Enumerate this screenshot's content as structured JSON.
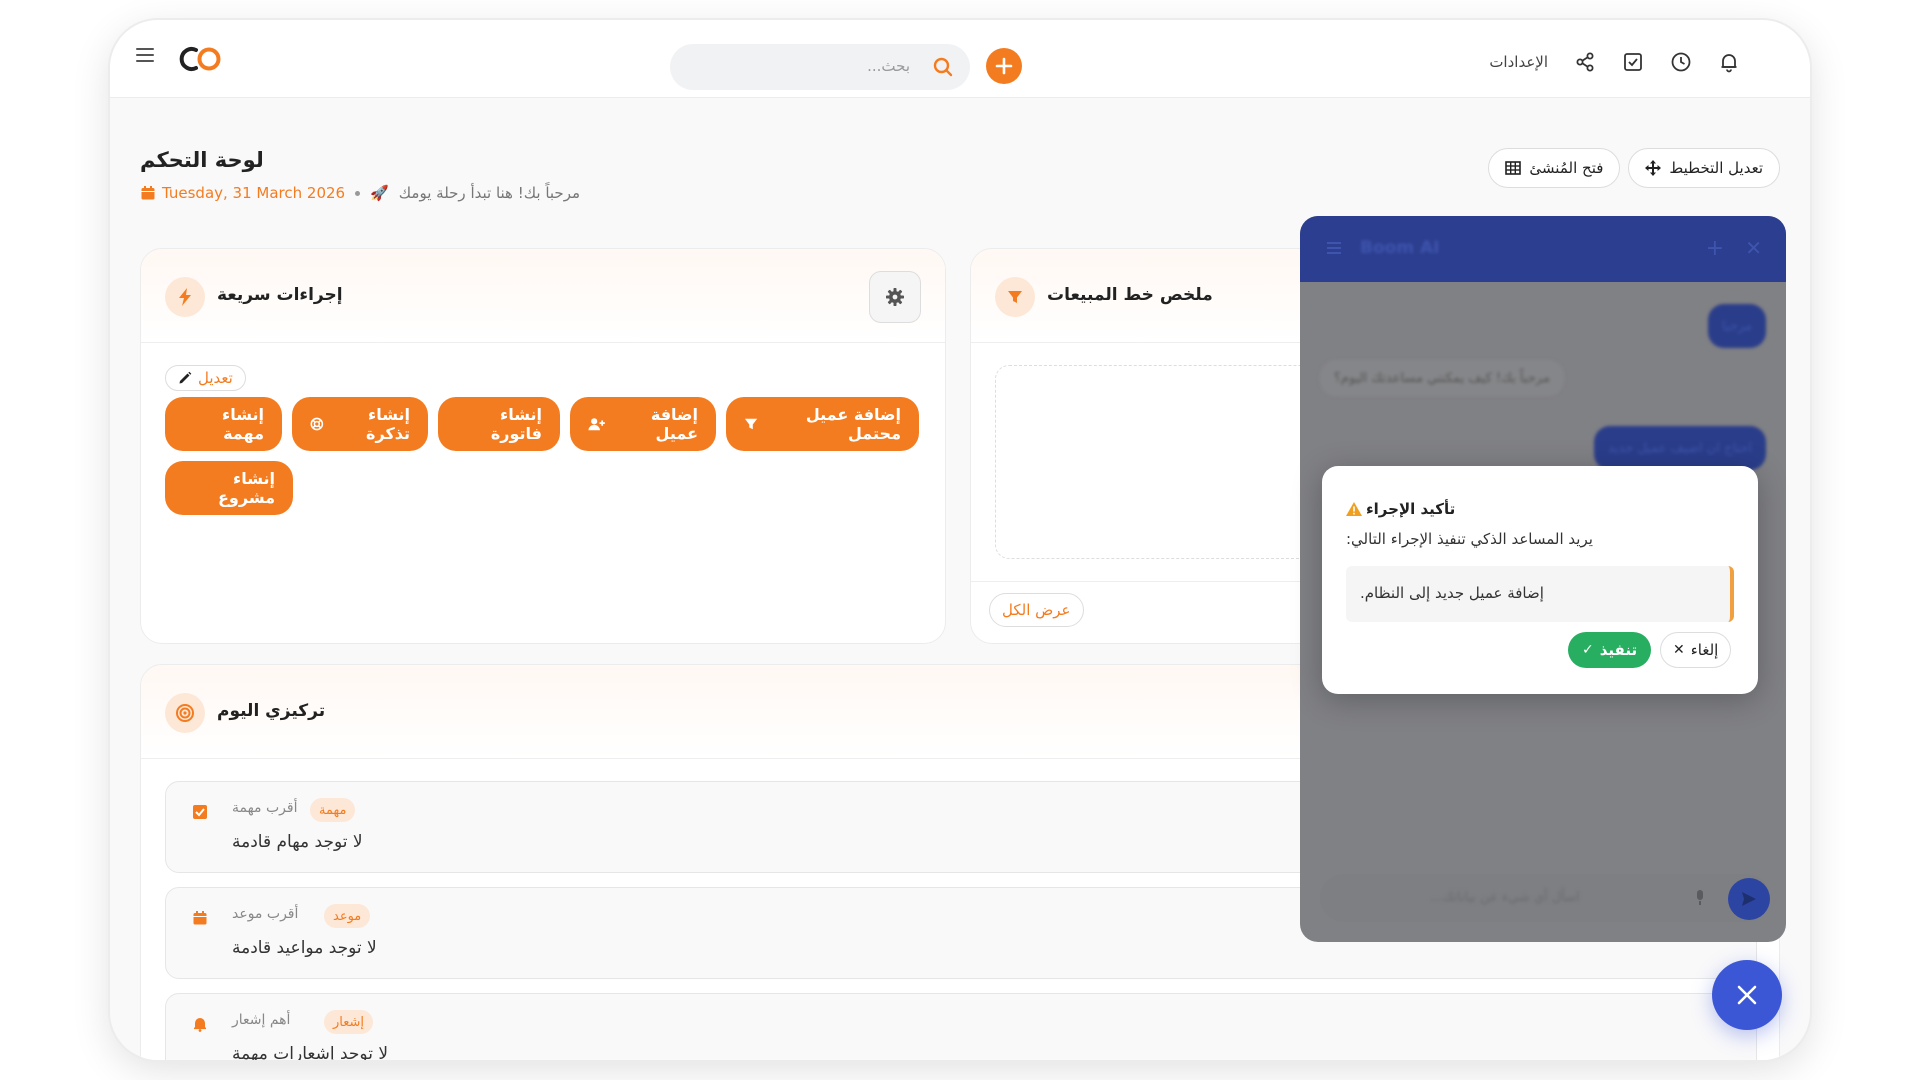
{
  "header": {
    "search_placeholder": "بحث...",
    "settings_label": "الإعدادات"
  },
  "page": {
    "title": "لوحة التحكم",
    "date": "Tuesday, 31 March 2026",
    "greeting": "مرحباً بك! هنا تبدأ رحلة يومك",
    "edit_layout": "تعديل التخطيط",
    "open_builder": "فتح المُنشئ"
  },
  "quick_actions": {
    "title": "إجراءات سريعة",
    "edit": "تعديل",
    "buttons": [
      "إضافة عميل محتمل",
      "إضافة عميل",
      "إنشاء فاتورة",
      "إنشاء تذكرة",
      "إنشاء مهمة",
      "إنشاء مشروع"
    ]
  },
  "sales_pipeline": {
    "title": "ملخص خط المبيعات",
    "view_all": "عرض الكل"
  },
  "focus": {
    "title": "تركيزي اليوم",
    "rows": [
      {
        "badge": "مهمة",
        "label": "أقرب مهمة",
        "text": "لا توجد مهام قادمة"
      },
      {
        "badge": "موعد",
        "label": "أقرب موعد",
        "text": "لا توجد مواعيد قادمة"
      },
      {
        "badge": "إشعار",
        "label": "أهم إشعار",
        "text": "لا توجد إشعارات مهمة"
      }
    ]
  },
  "chat": {
    "title": "Boom AI",
    "messages": [
      "مرحبا",
      "مرحباً بك! كيف يمكنني مساعدتك اليوم؟",
      "احتاج ان اضيف عميل جديد"
    ],
    "input_placeholder": "اسأل أي شيء عن بياناتك..."
  },
  "dialog": {
    "title": "تأكيد الإجراء",
    "message": "يريد المساعد الذكي تنفيذ الإجراء التالي:",
    "action": "إضافة عميل جديد إلى النظام.",
    "cancel": "إلغاء",
    "execute": "تنفيذ"
  },
  "colors": {
    "accent": "#f47c20",
    "chat_header": "#2c3e8f",
    "success": "#27ae60",
    "fab": "#3b57d6"
  }
}
